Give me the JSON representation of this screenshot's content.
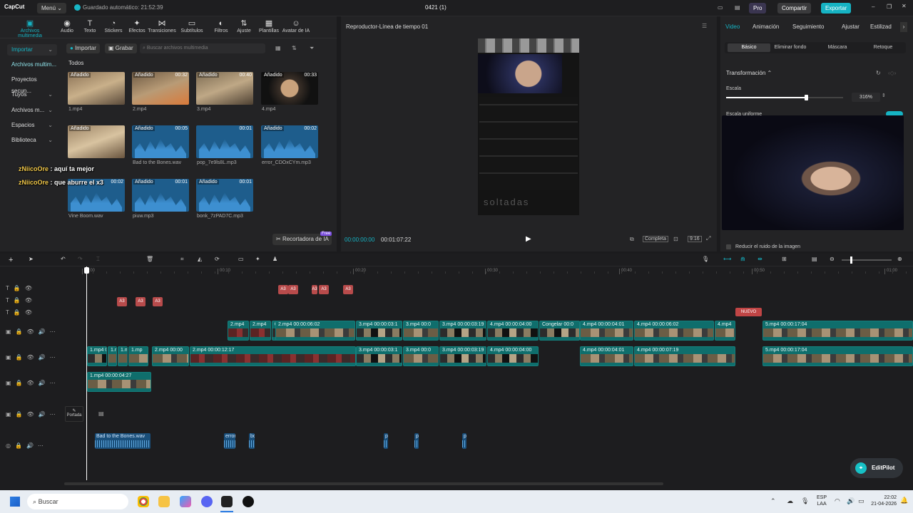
{
  "topbar": {
    "logo": "CapCut",
    "menu_label": "Menú",
    "autosave": "Guardado automático: 21:52:39",
    "project_title": "0421 (1)",
    "pro_label": "Pro",
    "share_label": "Compartir",
    "export_label": "Exportar"
  },
  "media_tools": [
    {
      "label": "Archivos multimedia",
      "icon": "media-icon"
    },
    {
      "label": "Audio",
      "icon": "audio-icon"
    },
    {
      "label": "Texto",
      "icon": "text-icon"
    },
    {
      "label": "Stickers",
      "icon": "sticker-icon"
    },
    {
      "label": "Efectos",
      "icon": "effects-icon"
    },
    {
      "label": "Transiciones",
      "icon": "transitions-icon"
    },
    {
      "label": "Subtítulos",
      "icon": "subtitles-icon"
    },
    {
      "label": "Filtros",
      "icon": "filters-icon"
    },
    {
      "label": "Ajuste",
      "icon": "adjust-icon"
    },
    {
      "label": "Plantillas",
      "icon": "templates-icon"
    },
    {
      "label": "Avatar de IA",
      "icon": "ai-avatar-icon"
    }
  ],
  "sidebar": [
    {
      "label": "Importar"
    },
    {
      "label": "Archivos multim..."
    },
    {
      "label": "Proyectos secun..."
    },
    {
      "label": "Tuyos"
    },
    {
      "label": "Archivos m..."
    },
    {
      "label": "Espacios"
    },
    {
      "label": "Biblioteca"
    }
  ],
  "media_actions": {
    "import": "Importar",
    "record": "Grabar",
    "search_placeholder": "Buscar archivos multimedia",
    "filter_all": "Todos"
  },
  "media_items": [
    {
      "name": "1.mp4",
      "badge": "Añadido",
      "duration": "",
      "kind": "video"
    },
    {
      "name": "2.mp4",
      "badge": "Añadido",
      "duration": "00:32",
      "kind": "video"
    },
    {
      "name": "3.mp4",
      "badge": "Añadido",
      "duration": "00:40",
      "kind": "video"
    },
    {
      "name": "4.mp4",
      "badge": "Añadido",
      "duration": "00:33",
      "kind": "video"
    },
    {
      "name": "",
      "badge": "Añadido",
      "duration": "",
      "kind": "video"
    },
    {
      "name": "Bad to the Bones.wav",
      "badge": "Añadido",
      "duration": "00:05",
      "kind": "audio"
    },
    {
      "name": "pop_7e9ls8L.mp3",
      "badge": "",
      "duration": "00:01",
      "kind": "audio"
    },
    {
      "name": "error_CDOxCYm.mp3",
      "badge": "Añadido",
      "duration": "00:02",
      "kind": "audio"
    },
    {
      "name": "Vine Boom.wav",
      "badge": "",
      "duration": "00:02",
      "kind": "audio"
    },
    {
      "name": "piuw.mp3",
      "badge": "Añadido",
      "duration": "00:01",
      "kind": "audio"
    },
    {
      "name": "bonk_7zPAD7C.mp3",
      "badge": "Añadido",
      "duration": "00:01",
      "kind": "audio"
    }
  ],
  "chat_overlay": [
    {
      "user": "zNiicoOre",
      "text": ": aquí ta mejor"
    },
    {
      "user": "zNiicoOre",
      "text": ": que aburre el x3"
    }
  ],
  "cutout_button": "Recortadora de IA",
  "cutout_badge": "Free",
  "player": {
    "title": "Reproductor-Línea de tiempo 01",
    "current_time": "00:00:00:00",
    "total_time": "00:01:07:22",
    "quality_label": "Completa",
    "ratio_label": "9:16",
    "preview_text": "soltadas"
  },
  "inspector": {
    "tabs": [
      "Video",
      "Animación",
      "Seguimiento",
      "Ajustar",
      "Estilizad"
    ],
    "subtabs": [
      "Básico",
      "Eliminar fondo",
      "Máscara",
      "Retoque"
    ],
    "section_title": "Transformación",
    "scale_label": "Escala",
    "scale_value": "316%",
    "scale_fraction": 0.68,
    "uniform_label": "Escala uniforme",
    "noise_label": "Reducir el ruido de la imagen"
  },
  "timeline": {
    "ruler_ticks": [
      "00:00",
      "00:10",
      "00:20",
      "00:30",
      "00:40",
      "00:50",
      "01:00"
    ],
    "new_badge": "NUEVO",
    "cover_label": "Portada",
    "text_clip_label": "A3"
  },
  "taskbar": {
    "search_placeholder": "Buscar",
    "lang_top": "ESP",
    "lang_bottom": "LAA",
    "time": "22:02",
    "date": "21-04-2026"
  },
  "editpilot_label": "EditPilot"
}
